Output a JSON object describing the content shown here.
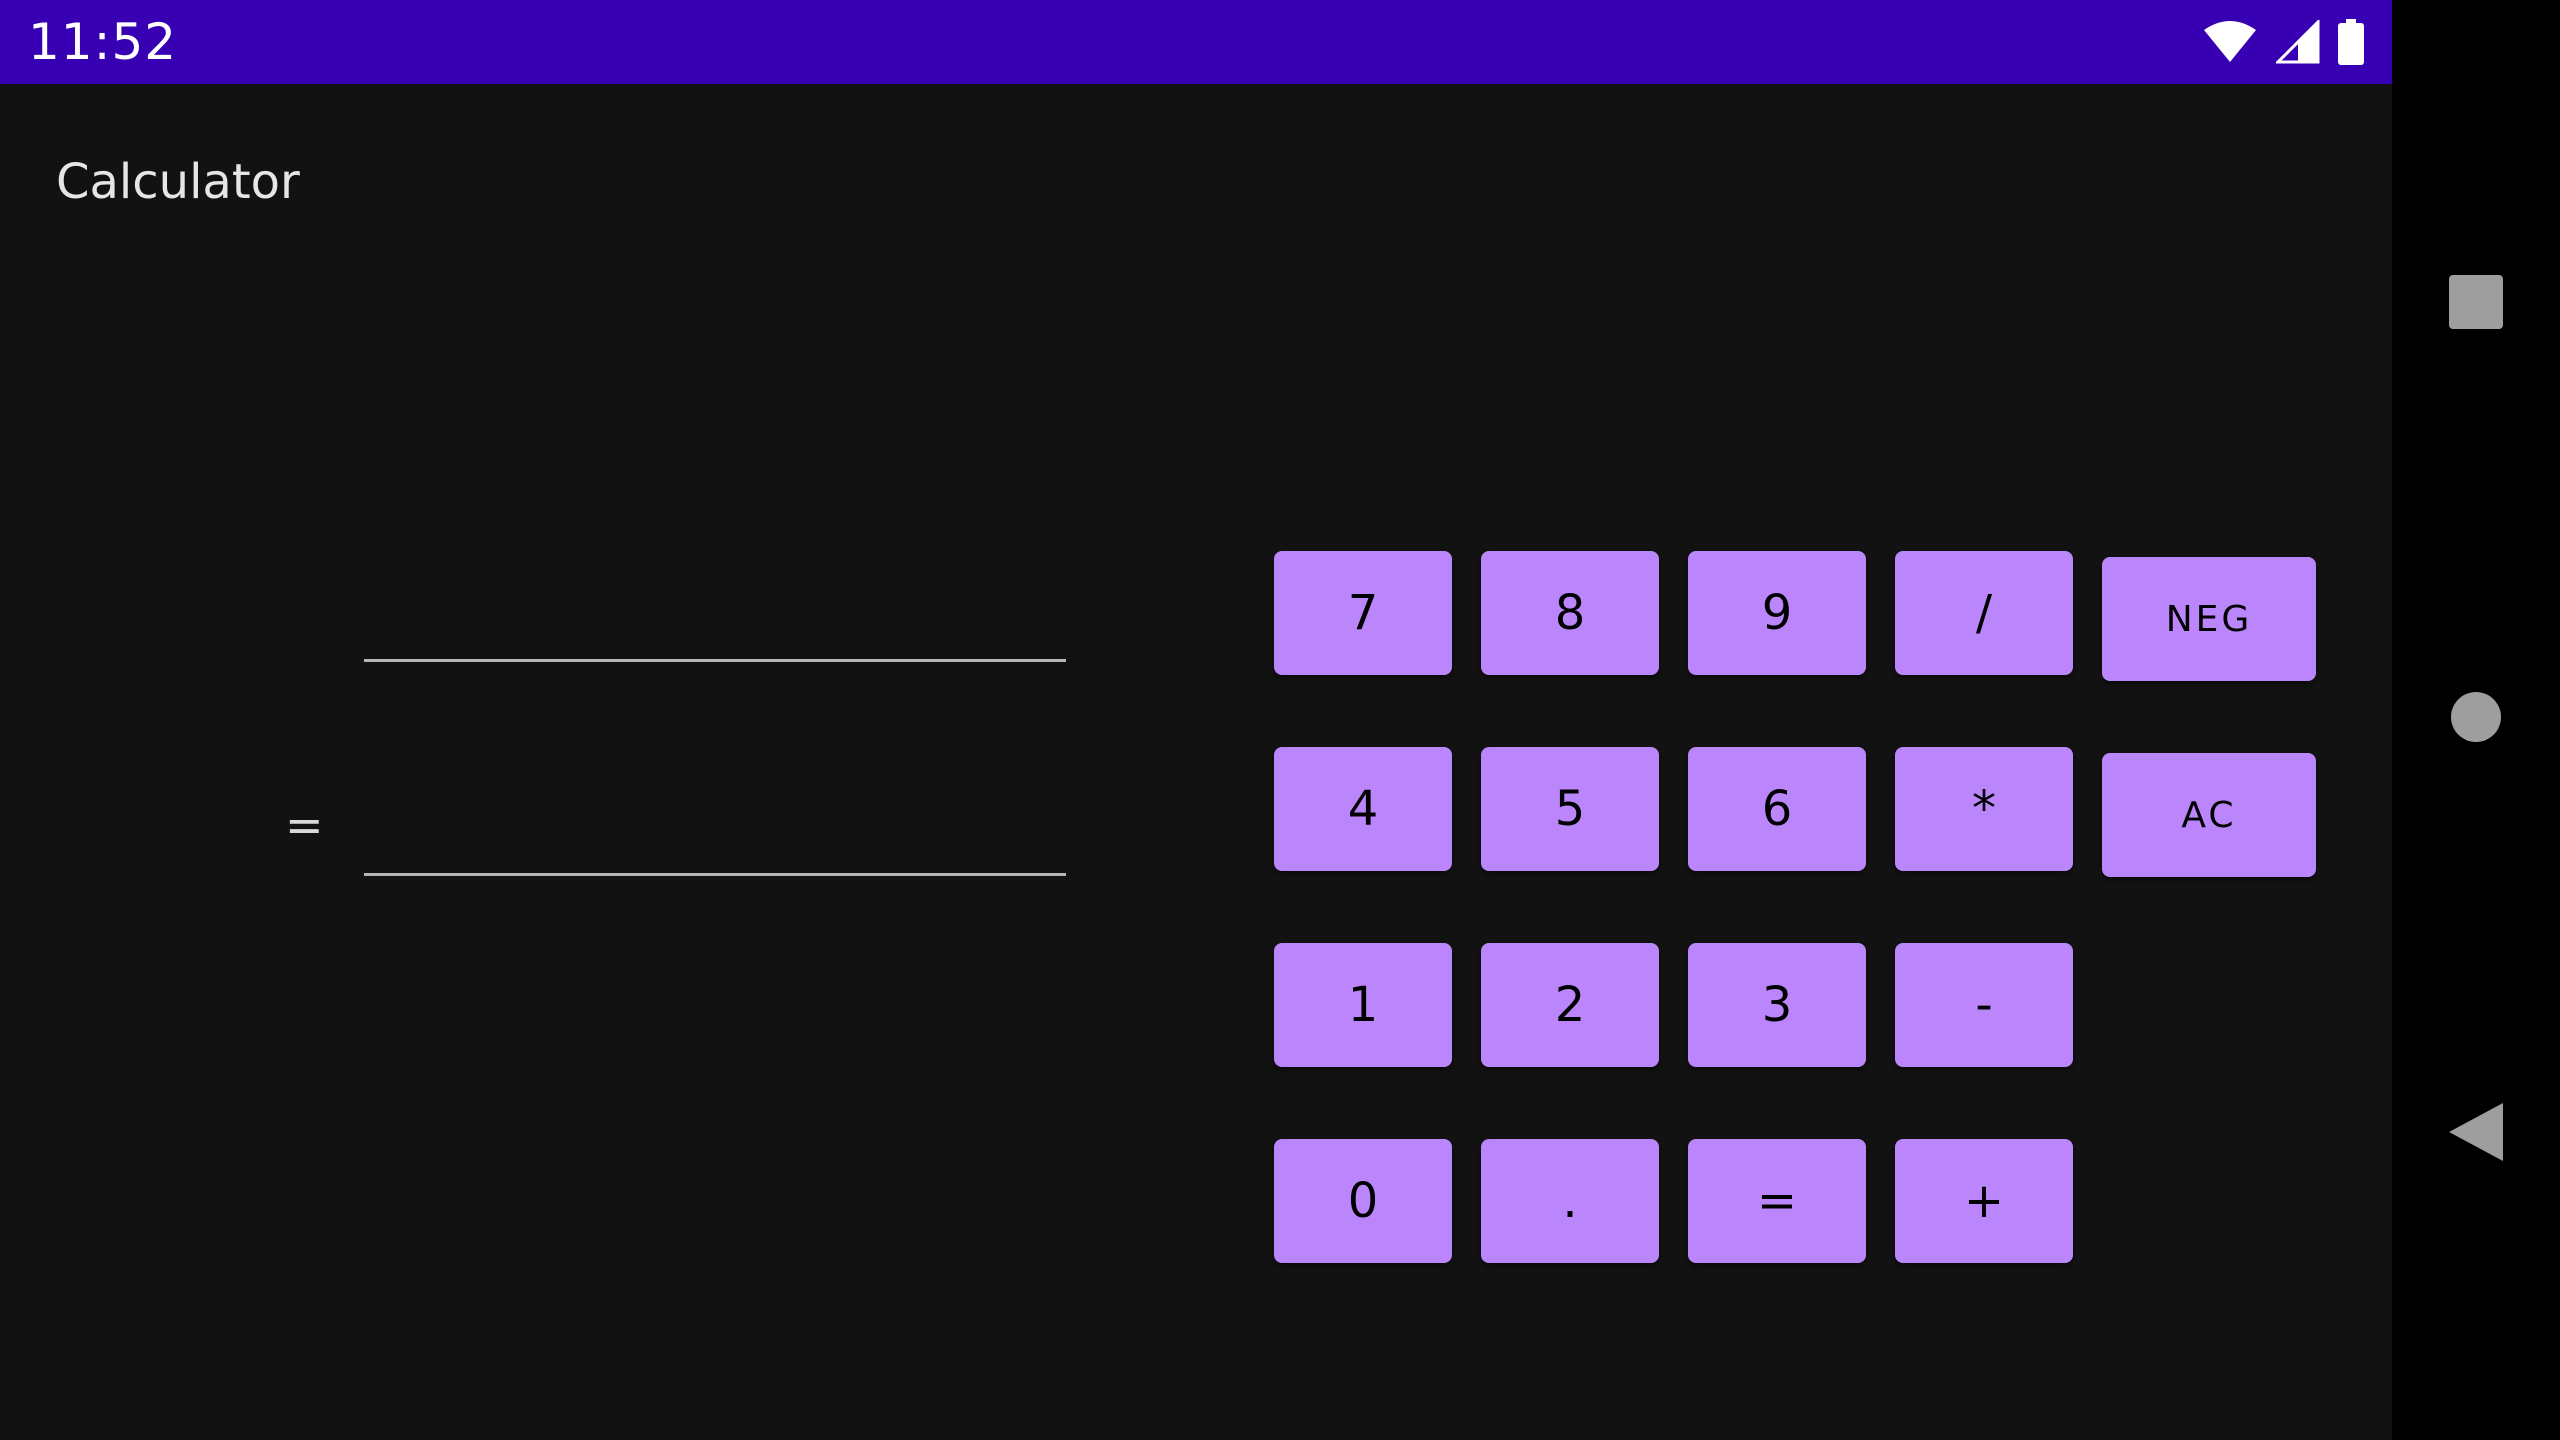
{
  "status_bar": {
    "time": "11:52",
    "background": "#3700b3",
    "icons": [
      "wifi-icon",
      "cell-signal-icon",
      "battery-icon"
    ]
  },
  "app": {
    "title": "Calculator",
    "expression_value": "",
    "result_value": "",
    "equals_label": "="
  },
  "keypad": {
    "key_color": "#bb86fc",
    "rows": [
      [
        "7",
        "8",
        "9",
        "/",
        "NEG"
      ],
      [
        "4",
        "5",
        "6",
        "*",
        "AC"
      ],
      [
        "1",
        "2",
        "3",
        "-"
      ],
      [
        "0",
        ".",
        "=",
        "+"
      ]
    ]
  },
  "nav_bar": {
    "buttons": [
      "recents-icon",
      "home-icon",
      "back-icon"
    ]
  }
}
